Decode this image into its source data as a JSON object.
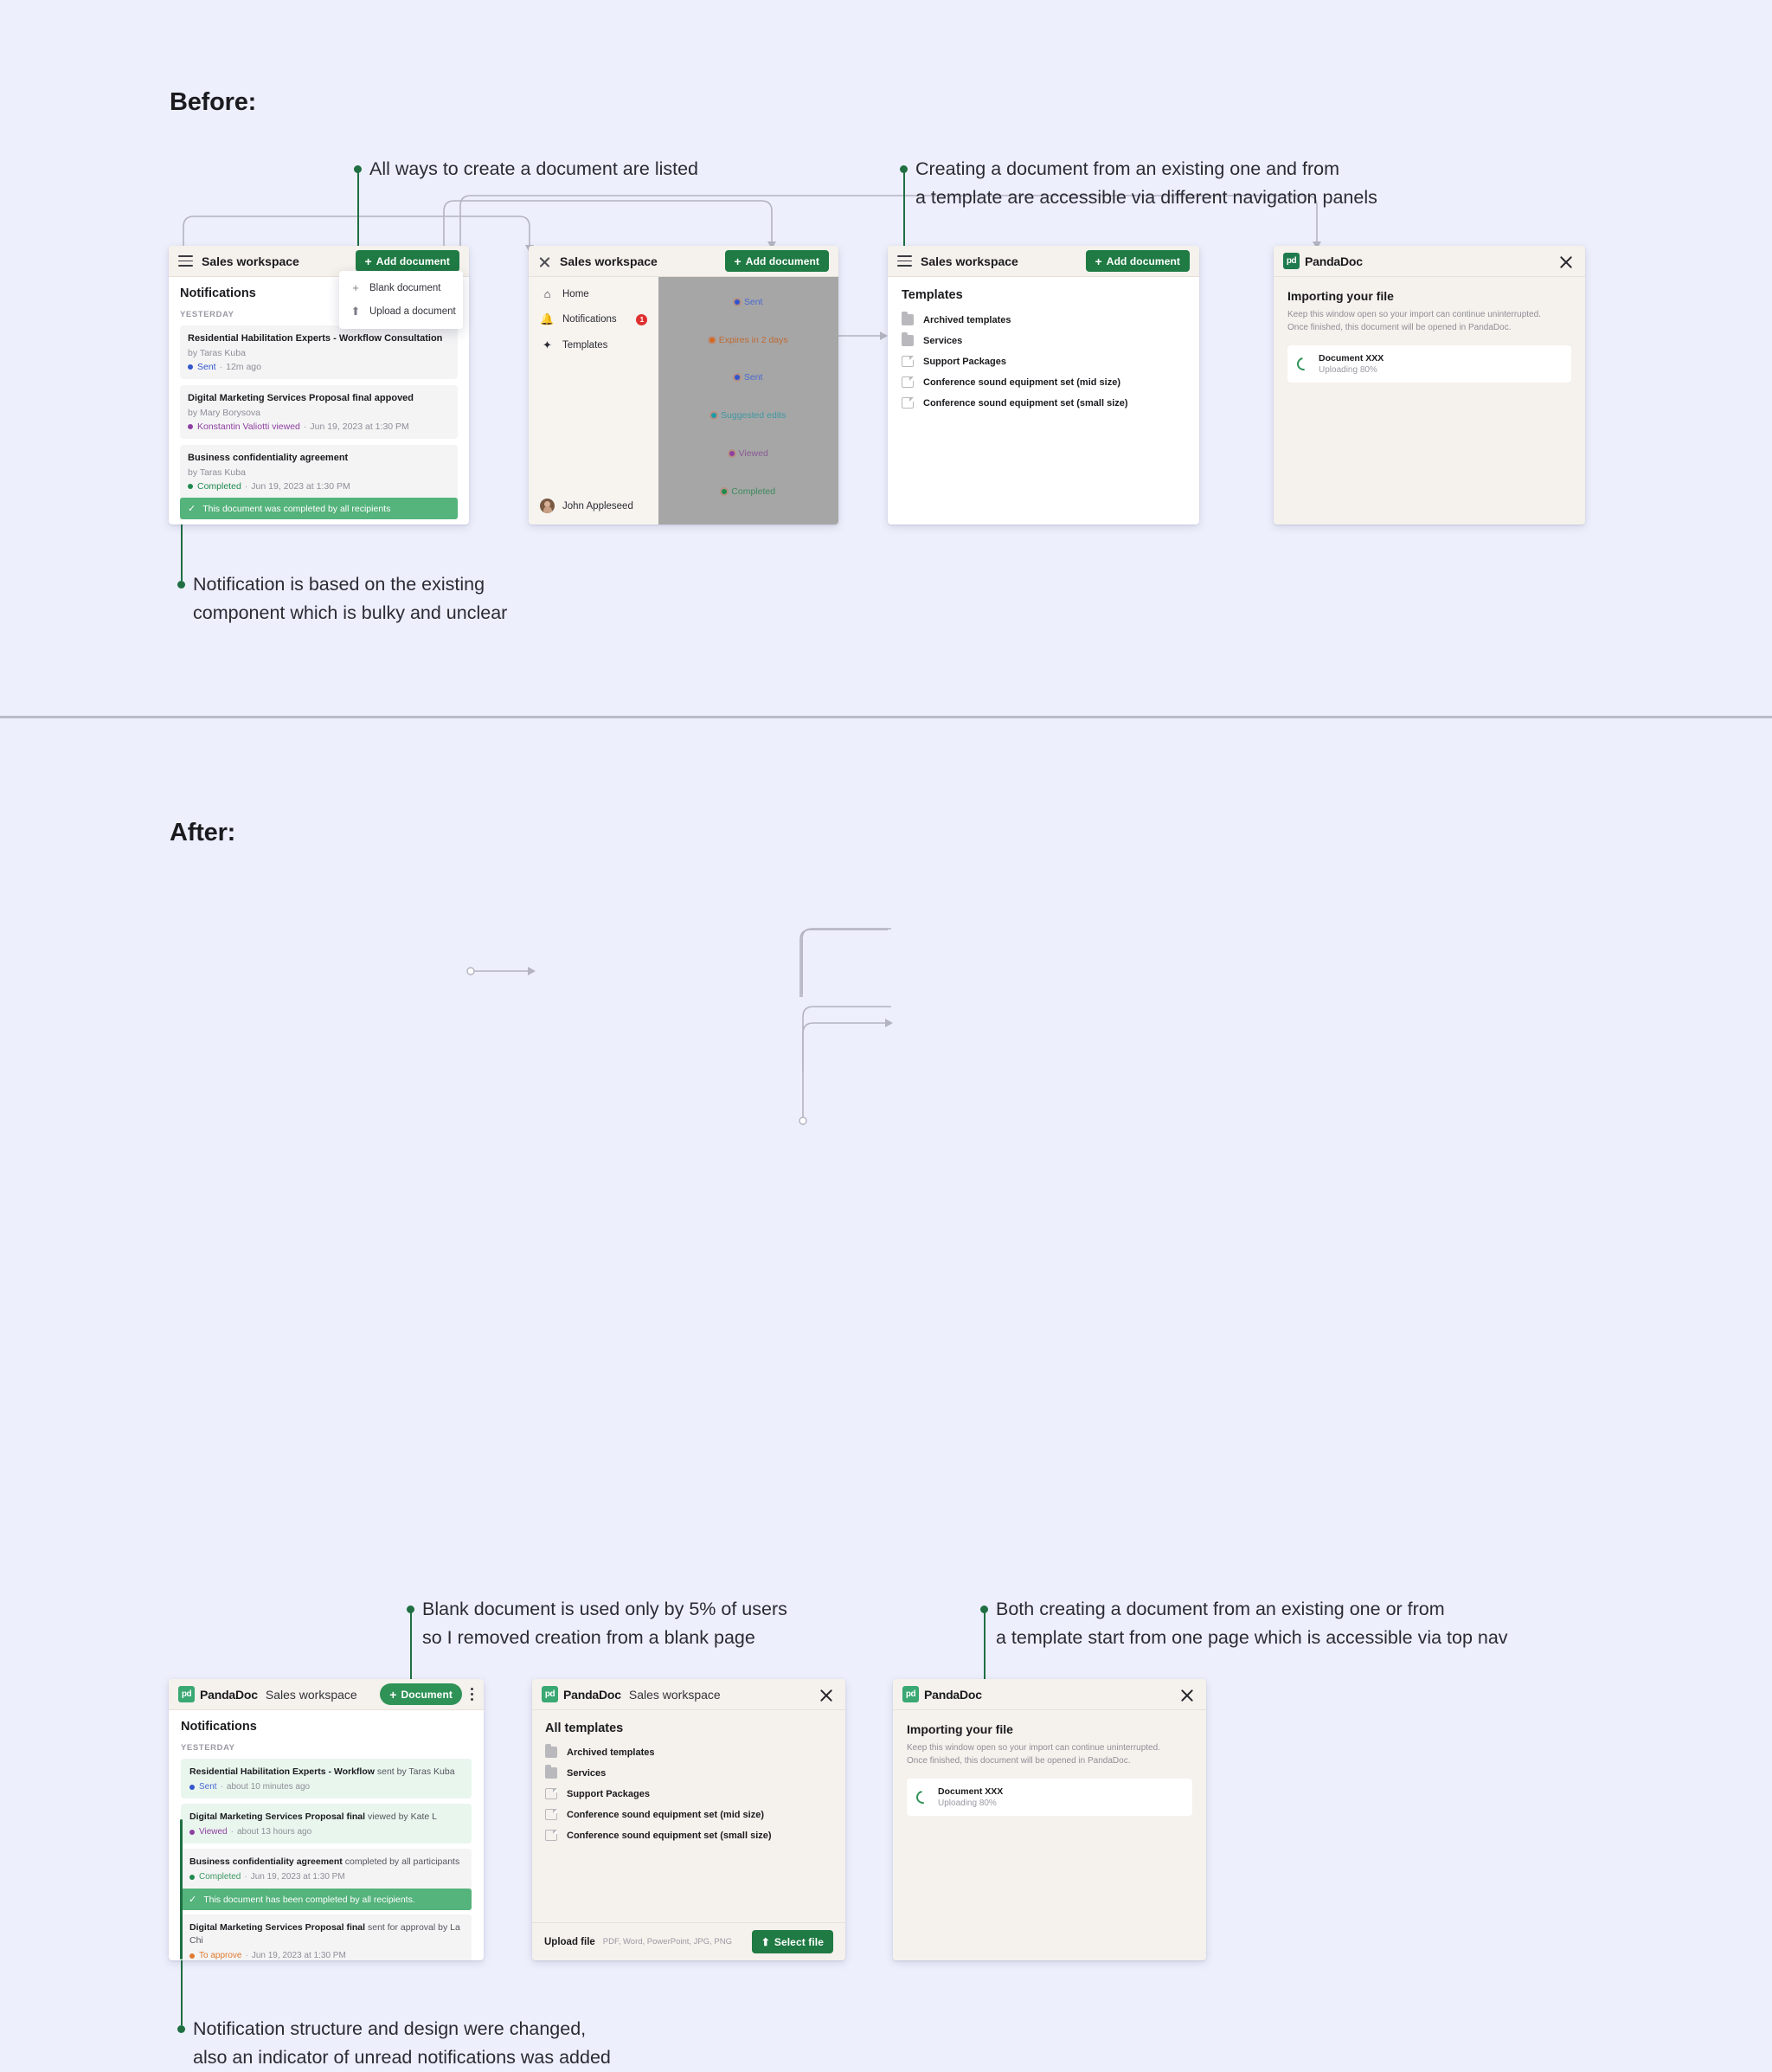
{
  "sections": {
    "before": {
      "title": "Before:"
    },
    "after": {
      "title": "After:"
    }
  },
  "annotations": {
    "before_create_ways": "All ways to create a document are listed",
    "before_nav_panels_l1": "Creating a document from an existing one and from",
    "before_nav_panels_l2": "a template are accessible via different navigation panels",
    "before_notification_l1": "Notification is based on the existing",
    "before_notification_l2": "component which is bulky and unclear",
    "after_blank_doc_l1": "Blank document is used only by 5% of users",
    "after_blank_doc_l2": "so I removed creation from a blank page",
    "after_one_page_l1": "Both creating a document from an existing one or from",
    "after_one_page_l2": "a template start from one page which is accessible via top nav",
    "after_notification_l1": "Notification structure and design were changed,",
    "after_notification_l2": "also an indicator of unread notifications was added"
  },
  "colors": {
    "accent_green": "#1f7a43",
    "annotation_green": "#1f6f43",
    "success_bar": "#55b37c",
    "unread_bg": "#e9f6ee",
    "badge_red": "#e03030",
    "page_bg": "#edeffc",
    "chrome_bg": "#f5f1ec",
    "sent_blue": "#3355cc",
    "viewed_purple": "#8e3fa0",
    "completed_green": "#1f8a4d",
    "expires_orange": "#d2691e",
    "suggested_teal": "#1f9aa8",
    "to_approve_orange": "#e07a2f"
  },
  "before": {
    "win1": {
      "workspace": "Sales workspace",
      "add_document": "Add document",
      "menu": [
        {
          "label": "Blank document",
          "icon": "plus-icon"
        },
        {
          "label": "Upload a document",
          "icon": "upload-icon"
        }
      ],
      "notifications_title": "Notifications",
      "group_label": "YESTERDAY",
      "cards": [
        {
          "title": "Residential Habilitation Experts - Workflow Consultation",
          "by": "by Taras Kuba",
          "status": "Sent",
          "status_color": "#3355cc",
          "time": "12m ago"
        },
        {
          "title": "Digital Marketing Services Proposal final appoved",
          "by": "by Mary Borysova",
          "status": "Konstantin Valiotti viewed",
          "status_color": "#8e3fa0",
          "time": "Jun 19, 2023 at 1:30 PM"
        },
        {
          "title": "Business confidentiality agreement",
          "by": "by Taras Kuba",
          "status": "Completed",
          "status_color": "#1f8a4d",
          "time": "Jun 19, 2023 at 1:30 PM"
        }
      ],
      "completed_banner": "This document was completed by all recipients"
    },
    "win2": {
      "workspace": "Sales workspace",
      "add_document": "Add document",
      "nav": [
        {
          "label": "Home",
          "icon": "home-icon",
          "badge": ""
        },
        {
          "label": "Notifications",
          "icon": "bell-icon",
          "badge": "1"
        },
        {
          "label": "Templates",
          "icon": "sparkle-icon",
          "badge": ""
        }
      ],
      "user": "John Appleseed",
      "dim_rows": [
        {
          "label": "Sent",
          "color": "#3355cc"
        },
        {
          "label": "Expires in 2 days",
          "color": "#d2691e"
        },
        {
          "label": "Sent",
          "color": "#3355cc"
        },
        {
          "label": "Suggested edits",
          "color": "#1f9aa8"
        },
        {
          "label": "Viewed",
          "color": "#8e3fa0"
        },
        {
          "label": "Completed",
          "color": "#1f8a4d"
        }
      ]
    },
    "win3": {
      "workspace": "Sales workspace",
      "add_document": "Add document",
      "list_title": "Templates",
      "items": [
        {
          "label": "Archived templates",
          "icon": "folder-icon"
        },
        {
          "label": "Services",
          "icon": "folder-icon"
        },
        {
          "label": "Support Packages",
          "icon": "document-icon"
        },
        {
          "label": "Conference sound equipment set (mid size)",
          "icon": "document-icon"
        },
        {
          "label": "Conference sound equipment set (small size)",
          "icon": "document-icon"
        }
      ]
    },
    "win4": {
      "brand": "PandaDoc",
      "brand_mark": "pd",
      "title": "Importing your file",
      "sub_l1": "Keep this window open so your import can continue uninterrupted.",
      "sub_l2": "Once finished, this document will be opened in PandaDoc.",
      "doc_name": "Document XXX",
      "progress": "Uploading 80%"
    }
  },
  "after": {
    "win1": {
      "brand": "PandaDoc",
      "brand_mark": "pd",
      "workspace": "Sales workspace",
      "add_document": "Document",
      "notifications_title": "Notifications",
      "group_label": "YESTERDAY",
      "rows": [
        {
          "bold": "Residential Habilitation Experts - Workflow",
          "rest": " sent by Taras Kuba",
          "status": "Sent",
          "status_color": "#3355cc",
          "time": "about 10 minutes ago",
          "unread": true
        },
        {
          "bold": "Digital Marketing Services Proposal final",
          "rest": " viewed by Kate L",
          "status": "Viewed",
          "status_color": "#8e3fa0",
          "time": "about 13 hours ago",
          "unread": true
        },
        {
          "bold": "Business confidentiality agreement",
          "rest": " completed by all participants",
          "status": "Completed",
          "status_color": "#1f8a4d",
          "time": "Jun 19, 2023 at 1:30 PM",
          "unread": false
        },
        {
          "bold": "Digital Marketing Services Proposal final",
          "rest": " sent for approval by La Chi",
          "status": "To approve",
          "status_color": "#e07a2f",
          "time": "Jun 19, 2023 at 1:30 PM",
          "unread": false
        }
      ],
      "completed_banner": "This document has been completed by all recipients."
    },
    "win2": {
      "brand": "PandaDoc",
      "brand_mark": "pd",
      "workspace": "Sales workspace",
      "list_title": "All templates",
      "items": [
        {
          "label": "Archived templates",
          "icon": "folder-icon"
        },
        {
          "label": "Services",
          "icon": "folder-icon"
        },
        {
          "label": "Support Packages",
          "icon": "document-icon"
        },
        {
          "label": "Conference sound equipment set (mid size)",
          "icon": "document-icon"
        },
        {
          "label": "Conference sound equipment set (small size)",
          "icon": "document-icon"
        }
      ],
      "upload_label": "Upload file",
      "upload_types": "PDF, Word, PowerPoint, JPG, PNG",
      "select_file": "Select file"
    },
    "win3": {
      "brand": "PandaDoc",
      "brand_mark": "pd",
      "title": "Importing your file",
      "sub_l1": "Keep this window open so your import can continue uninterrupted.",
      "sub_l2": "Once finished, this document will be opened in PandaDoc.",
      "doc_name": "Document XXX",
      "progress": "Uploading 80%"
    }
  }
}
